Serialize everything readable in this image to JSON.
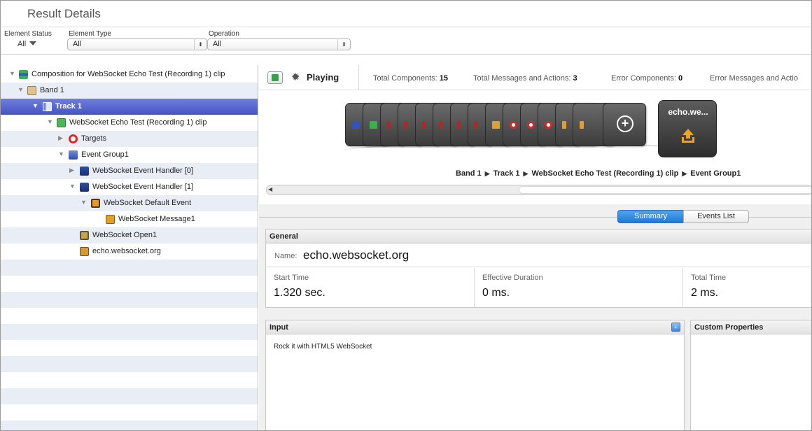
{
  "header": {
    "title": "Result Details"
  },
  "filters": {
    "element_status_label": "Element Status",
    "element_status_value": "All",
    "element_type_label": "Element Type",
    "element_type_value": "All",
    "operation_label": "Operation",
    "operation_value": "All"
  },
  "tree": {
    "items": [
      {
        "label": "Composition for WebSocket Echo Test (Recording 1) clip",
        "icon": "composition-icon"
      },
      {
        "label": "Band 1",
        "icon": "band-icon"
      },
      {
        "label": "Track 1",
        "icon": "track-icon"
      },
      {
        "label": "WebSocket Echo Test (Recording 1) clip",
        "icon": "clip-icon"
      },
      {
        "label": "Targets",
        "icon": "target-icon"
      },
      {
        "label": "Event Group1",
        "icon": "event-group-icon"
      },
      {
        "label": "WebSocket Event Handler [0]",
        "icon": "event-handler-icon"
      },
      {
        "label": "WebSocket Event Handler [1]",
        "icon": "event-handler-icon"
      },
      {
        "label": "WebSocket Default Event",
        "icon": "default-event-icon"
      },
      {
        "label": "WebSocket Message1",
        "icon": "message-icon"
      },
      {
        "label": "WebSocket Open1",
        "icon": "open-icon"
      },
      {
        "label": "echo.websocket.org",
        "icon": "endpoint-icon"
      }
    ]
  },
  "status": {
    "state": "Playing",
    "total_components_label": "Total Components:",
    "total_components": "15",
    "total_messages_label": "Total Messages and Actions:",
    "total_messages": "3",
    "error_components_label": "Error Components:",
    "error_components": "0",
    "error_messages_label": "Error Messages and Actio"
  },
  "timeline": {
    "end_card_title": "echo.we...",
    "breadcrumb": [
      "Band 1",
      "Track 1",
      "WebSocket Echo Test (Recording 1) clip",
      "Event Group1"
    ]
  },
  "tabs": {
    "summary": "Summary",
    "events_list": "Events List"
  },
  "general": {
    "heading": "General",
    "name_label": "Name:",
    "name_value": "echo.websocket.org",
    "start_time_label": "Start Time",
    "start_time_value": "1.320 sec.",
    "effective_duration_label": "Effective Duration",
    "effective_duration_value": "0 ms.",
    "total_time_label": "Total Time",
    "total_time_value": "2 ms."
  },
  "input_panel": {
    "heading": "Input",
    "body": "Rock it with HTML5 WebSocket"
  },
  "custom_properties": {
    "heading": "Custom Properties"
  },
  "colors": {
    "selection": "#4553c6",
    "tab_active": "#1f78d6",
    "stripe": "#e9eef6"
  }
}
